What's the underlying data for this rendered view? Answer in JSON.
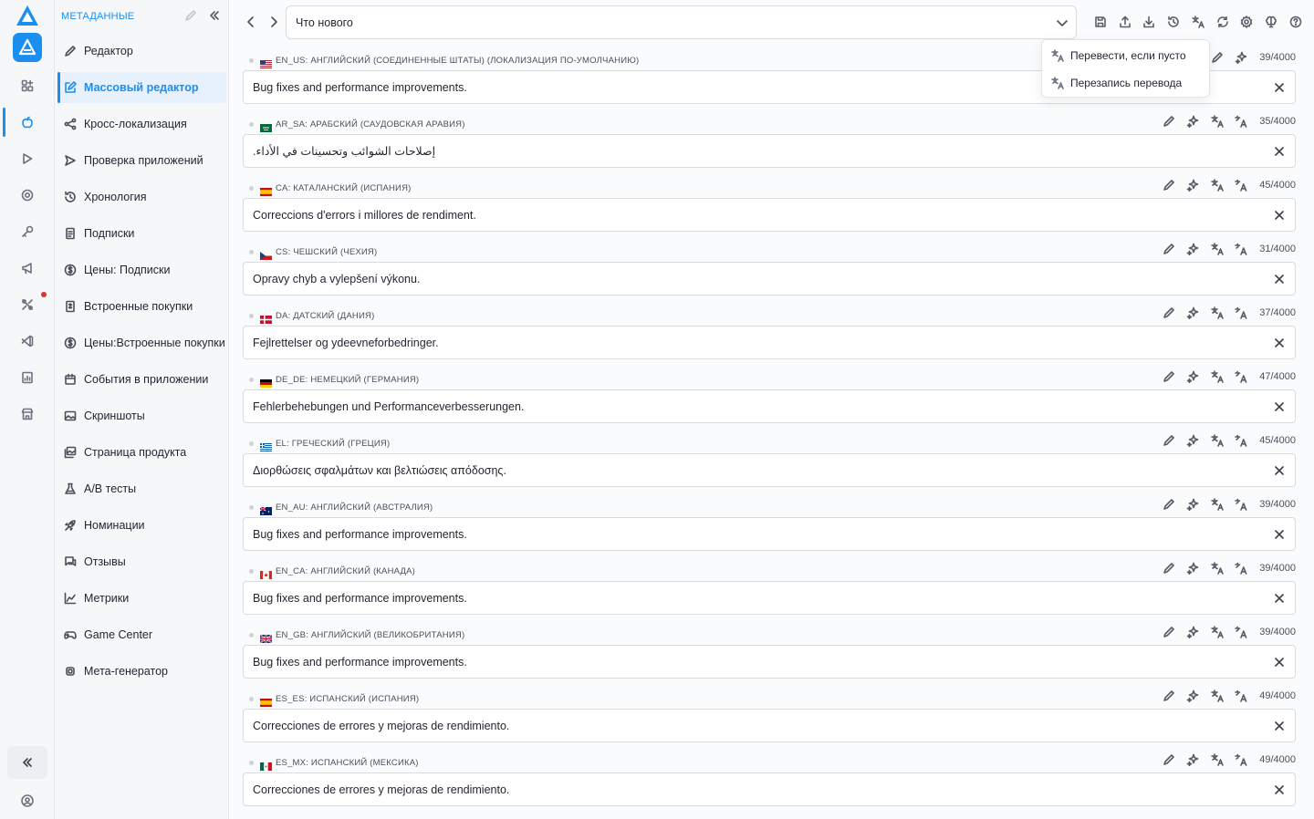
{
  "nav": {
    "header": "МЕТАДАННЫЕ",
    "items": [
      {
        "label": "Редактор",
        "icon": "pencil-icon"
      },
      {
        "label": "Массовый редактор",
        "icon": "edit-square-icon",
        "active": true
      },
      {
        "label": "Кросс-локализация",
        "icon": "share-icon"
      },
      {
        "label": "Проверка приложений",
        "icon": "send-icon"
      },
      {
        "label": "Хронология",
        "icon": "history-icon"
      },
      {
        "label": "Подписки",
        "icon": "document-icon"
      },
      {
        "label": "Цены: Подписки",
        "icon": "dollar-circle-icon"
      },
      {
        "label": "Встроенные покупки",
        "icon": "receipt-icon"
      },
      {
        "label": "Цены:Встроенные покупки",
        "icon": "dollar-circle-icon"
      },
      {
        "label": "События в приложении",
        "icon": "calendar-icon"
      },
      {
        "label": "Скриншоты",
        "icon": "image-icon"
      },
      {
        "label": "Страница продукта",
        "icon": "images-icon"
      },
      {
        "label": "A/B тесты",
        "icon": "flask-icon"
      },
      {
        "label": "Номинации",
        "icon": "rocket-icon"
      },
      {
        "label": "Отзывы",
        "icon": "chat-icon"
      },
      {
        "label": "Метрики",
        "icon": "chart-icon"
      },
      {
        "label": "Game Center",
        "icon": "gamepad-icon"
      },
      {
        "label": "Мета-генератор",
        "icon": "chip-icon"
      }
    ]
  },
  "rail": {
    "accent": "#1b8ff0",
    "icons": [
      "widgets-icon",
      "apple-icon",
      "play-icon",
      "target-icon",
      "key-icon",
      "megaphone-icon",
      "tools-icon",
      "vscode-icon",
      "report-icon",
      "store-icon"
    ],
    "notification_color": "#e0312f"
  },
  "toolbar": {
    "field_value": "Что нового",
    "icons": [
      "save-icon",
      "upload-icon",
      "download-icon",
      "history-icon",
      "translate-icon",
      "refresh-icon",
      "settings-icon",
      "brain-icon",
      "help-icon"
    ]
  },
  "dropdown": {
    "items": [
      {
        "label": "Перевести, если пусто",
        "icon": "translate-fill-icon"
      },
      {
        "label": "Перезапись перевода",
        "icon": "translate-overwrite-icon"
      }
    ]
  },
  "locales": [
    {
      "code": "EN_US",
      "label": "EN_US: АНГЛИЙСКИЙ (СОЕДИНЕННЫЕ ШТАТЫ) (ЛОКАЛИЗАЦИЯ ПО-УМОЛЧАНИЮ)",
      "flag": "us",
      "count": "39/4000",
      "text": "Bug fixes and performance improvements."
    },
    {
      "code": "AR_SA",
      "label": "AR_SA: АРАБСКИЙ (САУДОВСКАЯ АРАВИЯ)",
      "flag": "sa",
      "count": "35/4000",
      "text": "إصلاحات الشوائب وتحسينات في الأداء.",
      "rtl": true
    },
    {
      "code": "CA",
      "label": "CA: КАТАЛАНСКИЙ (ИСПАНИЯ)",
      "flag": "es",
      "count": "45/4000",
      "text": "Correccions d'errors i millores de rendiment."
    },
    {
      "code": "CS",
      "label": "CS: ЧЕШСКИЙ (ЧЕХИЯ)",
      "flag": "cz",
      "count": "31/4000",
      "text": "Opravy chyb a vylepšení výkonu."
    },
    {
      "code": "DA",
      "label": "DA: ДАТСКИЙ (ДАНИЯ)",
      "flag": "dk",
      "count": "37/4000",
      "text": "Fejlrettelser og ydeevneforbedringer."
    },
    {
      "code": "DE_DE",
      "label": "DE_DE: НЕМЕЦКИЙ (ГЕРМАНИЯ)",
      "flag": "de",
      "count": "47/4000",
      "text": "Fehlerbehebungen und Performanceverbesserungen."
    },
    {
      "code": "EL",
      "label": "EL: ГРЕЧЕСКИЙ (ГРЕЦИЯ)",
      "flag": "gr",
      "count": "45/4000",
      "text": "Διορθώσεις σφαλμάτων και βελτιώσεις απόδοσης."
    },
    {
      "code": "EN_AU",
      "label": "EN_AU: АНГЛИЙСКИЙ (АВСТРАЛИЯ)",
      "flag": "au",
      "count": "39/4000",
      "text": "Bug fixes and performance improvements."
    },
    {
      "code": "EN_CA",
      "label": "EN_CA: АНГЛИЙСКИЙ (КАНАДА)",
      "flag": "ca",
      "count": "39/4000",
      "text": "Bug fixes and performance improvements."
    },
    {
      "code": "EN_GB",
      "label": "EN_GB: АНГЛИЙСКИЙ (ВЕЛИКОБРИТАНИЯ)",
      "flag": "gb",
      "count": "39/4000",
      "text": "Bug fixes and performance improvements."
    },
    {
      "code": "ES_ES",
      "label": "ES_ES: ИСПАНСКИЙ (ИСПАНИЯ)",
      "flag": "es",
      "count": "49/4000",
      "text": "Correcciones de errores y mejoras de rendimiento."
    },
    {
      "code": "ES_MX",
      "label": "ES_MX: ИСПАНСКИЙ (МЕКСИКА)",
      "flag": "mx",
      "count": "49/4000",
      "text": "Correcciones de errores y mejoras de rendimiento."
    }
  ],
  "row_icons": [
    "edit-icon",
    "ai-sparkle-icon",
    "translate-icon",
    "char-count-icon"
  ],
  "clear_icon": "close-icon"
}
